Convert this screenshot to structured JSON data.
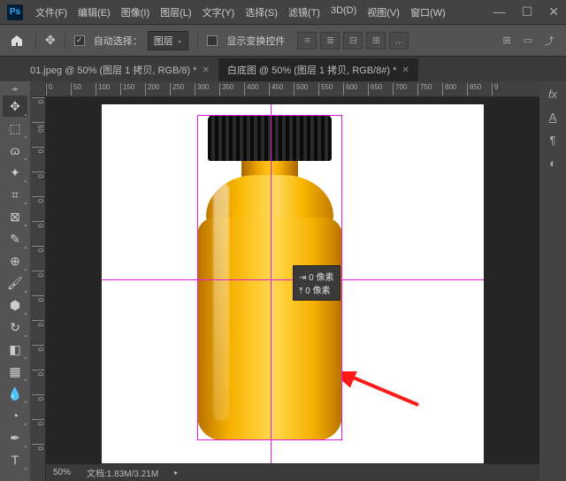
{
  "app": {
    "logo": "Ps"
  },
  "menu": {
    "file": "文件(F)",
    "edit": "编辑(E)",
    "image": "图像(I)",
    "layer": "图层(L)",
    "type": "文字(Y)",
    "select": "选择(S)",
    "filter": "滤镜(T)",
    "threed": "3D(D)",
    "view": "视图(V)",
    "window": "窗口(W)"
  },
  "win": {
    "min": "—",
    "max": "☐",
    "close": "✕"
  },
  "options": {
    "auto_select": "自动选择：",
    "layer_dd": "图层",
    "show_transform": "显示变换控件"
  },
  "tabs": {
    "t1": "01.jpeg @ 50% (图层 1 拷贝, RGB/8) *",
    "t2": "白底图 @ 50% (图层 1 拷贝, RGB/8#) *"
  },
  "ruler_h": [
    "0",
    "50",
    "100",
    "150",
    "200",
    "250",
    "300",
    "350",
    "400",
    "450",
    "500",
    "550",
    "600",
    "650",
    "700",
    "750",
    "800",
    "850",
    "9"
  ],
  "ruler_v": [
    "0",
    "50",
    "0",
    "0",
    "0",
    "0",
    "0",
    "0",
    "0",
    "0",
    "0",
    "0",
    "0",
    "0",
    "0",
    "0",
    "0"
  ],
  "measure": {
    "l1": "⇥ 0 像素",
    "l2": "⤒ 0 像素"
  },
  "status": {
    "zoom": "50%",
    "doc": "文档:1.83M/3.21M"
  },
  "right": {
    "fx": "fx",
    "a": "A",
    "para": "¶",
    "swatch": "◐"
  }
}
